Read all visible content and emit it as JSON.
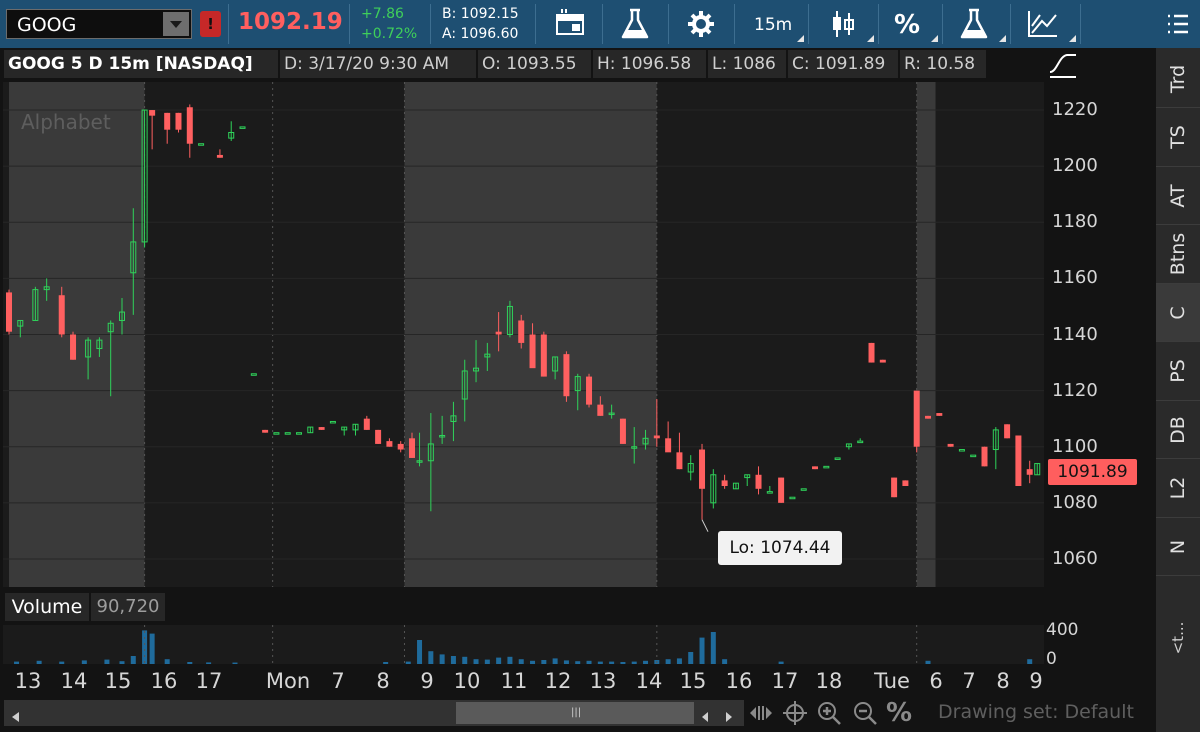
{
  "toolbar": {
    "symbol": "GOOG",
    "alert_badge": "!",
    "last_price": "1092.19",
    "change": "+7.86",
    "change_pct": "+0.72%",
    "bid": "B: 1092.15",
    "ask": "A: 1096.60",
    "aggregation": "15m",
    "icons": [
      "style-icon",
      "flask-icon",
      "gear-icon",
      "candle-chart-icon",
      "percent-icon",
      "flask-icon",
      "drawing-icon",
      "menu-icon"
    ]
  },
  "info_bar": {
    "title": "GOOG 5 D 15m [NASDAQ]",
    "date": "D: 3/17/20 9:30 AM",
    "open": "O: 1093.55",
    "high": "H: 1096.58",
    "low": "L: 1086",
    "close": "C: 1091.89",
    "range": "R: 10.58"
  },
  "chart": {
    "watermark": "Alphabet",
    "price_tag": "1091.89",
    "tooltip": "Lo: 1074.44",
    "colors": {
      "up": "#2fd35a",
      "down": "#ff6060",
      "volume": "#1f6b9c",
      "bg_dark": "#1b1b1b",
      "bg_light": "#3a3a3a"
    }
  },
  "volume": {
    "label": "Volume",
    "value": "90,720",
    "axis": [
      "400",
      "0"
    ]
  },
  "time_axis": [
    "13",
    "14",
    "15",
    "16",
    "17",
    "Mon",
    "7",
    "8",
    "9",
    "10",
    "11",
    "12",
    "13",
    "14",
    "15",
    "16",
    "17",
    "18",
    "Tue",
    "6",
    "7",
    "8",
    "9"
  ],
  "bottom": {
    "drawing_set": "Drawing set: Default"
  },
  "right_tabs": [
    "Trd",
    "TS",
    "AT",
    "Btns",
    "C",
    "PS",
    "DB",
    "L2",
    "N"
  ],
  "right_more": "<t...",
  "chart_data": {
    "type": "candlestick",
    "title": "GOOG 5 D 15m [NASDAQ]",
    "ylim": [
      1050,
      1230
    ],
    "y_ticks": [
      1220,
      1200,
      1180,
      1160,
      1140,
      1120,
      1100,
      1080,
      1060
    ],
    "session_shading": [
      {
        "from": 0,
        "to": 36,
        "type": "light"
      },
      {
        "from": 36,
        "to": 105,
        "type": "dark"
      },
      {
        "from": 105,
        "to": 172,
        "type": "light"
      },
      {
        "from": 172,
        "to": 241,
        "type": "dark"
      },
      {
        "from": 241,
        "to": 246,
        "type": "light"
      }
    ],
    "candles": [
      [
        0,
        1155,
        1156,
        1140,
        1141
      ],
      [
        3,
        1143,
        1145,
        1139,
        1145
      ],
      [
        7,
        1145,
        1157,
        1145,
        1156
      ],
      [
        10,
        1156,
        1160,
        1152,
        1157
      ],
      [
        14,
        1154,
        1157,
        1139,
        1140
      ],
      [
        17,
        1140,
        1141,
        1131,
        1131
      ],
      [
        21,
        1132,
        1139,
        1124,
        1138
      ],
      [
        24,
        1135,
        1139,
        1132,
        1138
      ],
      [
        27,
        1141,
        1145,
        1118,
        1144
      ],
      [
        30,
        1145,
        1153,
        1140,
        1148
      ],
      [
        33,
        1162,
        1185,
        1147,
        1173
      ],
      [
        36,
        1173,
        1220,
        1171,
        1220
      ],
      [
        38,
        1220,
        1220,
        1206,
        1218
      ],
      [
        42,
        1219,
        1219,
        1208,
        1213
      ],
      [
        45,
        1219,
        1219,
        1212,
        1213
      ],
      [
        48,
        1221,
        1222,
        1203,
        1208
      ],
      [
        51,
        1208,
        1208,
        1208,
        1208
      ],
      [
        56,
        1204,
        1206,
        1203,
        1203
      ],
      [
        59,
        1210,
        1216,
        1209,
        1212
      ],
      [
        62,
        1214,
        1214,
        1214,
        1214
      ],
      [
        65,
        1126,
        1126,
        1126,
        1126
      ],
      [
        68,
        1106,
        1106,
        1105,
        1105
      ],
      [
        71,
        1105,
        1105,
        1105,
        1105
      ],
      [
        74,
        1105,
        1105,
        1105,
        1105
      ],
      [
        77,
        1105,
        1105,
        1105,
        1105
      ],
      [
        80,
        1105,
        1107,
        1105,
        1107
      ],
      [
        83,
        1107,
        1107,
        1106,
        1106
      ],
      [
        86,
        1109,
        1109,
        1109,
        1109
      ],
      [
        89,
        1106,
        1107,
        1104,
        1107
      ],
      [
        92,
        1106,
        1108,
        1104,
        1108
      ],
      [
        95,
        1110,
        1111,
        1106,
        1106
      ],
      [
        98,
        1106,
        1106,
        1101,
        1101
      ],
      [
        101,
        1102,
        1103,
        1100,
        1100
      ],
      [
        104,
        1101,
        1102,
        1098,
        1099
      ],
      [
        107,
        1103,
        1105,
        1096,
        1096
      ],
      [
        109,
        1095,
        1105,
        1093,
        1095
      ],
      [
        112,
        1095,
        1112,
        1077,
        1101
      ],
      [
        115,
        1104,
        1111,
        1101,
        1104
      ],
      [
        118,
        1109,
        1116,
        1102,
        1111
      ],
      [
        121,
        1117,
        1131,
        1109,
        1127
      ],
      [
        124,
        1127,
        1138,
        1123,
        1128
      ],
      [
        127,
        1132,
        1137,
        1127,
        1133
      ],
      [
        130,
        1141,
        1148,
        1134,
        1140
      ],
      [
        133,
        1140,
        1152,
        1139,
        1150
      ],
      [
        136,
        1145,
        1147,
        1135,
        1137
      ],
      [
        139,
        1140,
        1144,
        1131,
        1128
      ],
      [
        142,
        1140,
        1141,
        1125,
        1125
      ],
      [
        145,
        1127,
        1132,
        1124,
        1132
      ],
      [
        148,
        1133,
        1134,
        1116,
        1118
      ],
      [
        151,
        1120,
        1126,
        1113,
        1125
      ],
      [
        154,
        1125,
        1126,
        1114,
        1115
      ],
      [
        157,
        1115,
        1118,
        1111,
        1111
      ],
      [
        160,
        1112,
        1115,
        1110,
        1112
      ],
      [
        163,
        1110,
        1110,
        1101,
        1101
      ],
      [
        166,
        1100,
        1107,
        1094,
        1100
      ],
      [
        169,
        1101,
        1106,
        1099,
        1103
      ],
      [
        172,
        1104,
        1117,
        1100,
        1103
      ],
      [
        175,
        1103,
        1109,
        1101,
        1098
      ],
      [
        178,
        1098,
        1105,
        1092,
        1092
      ],
      [
        181,
        1091,
        1097,
        1088,
        1094
      ],
      [
        184,
        1099,
        1101,
        1074,
        1085
      ],
      [
        187,
        1080,
        1092,
        1078,
        1090
      ],
      [
        190,
        1088,
        1090,
        1085,
        1086
      ],
      [
        193,
        1085,
        1087,
        1085,
        1087
      ],
      [
        196,
        1089,
        1090,
        1086,
        1090
      ],
      [
        199,
        1090,
        1093,
        1083,
        1085
      ],
      [
        202,
        1084,
        1086,
        1084,
        1084
      ],
      [
        205,
        1089,
        1089,
        1080,
        1080
      ],
      [
        208,
        1082,
        1082,
        1082,
        1082
      ],
      [
        211,
        1085,
        1085,
        1085,
        1085
      ],
      [
        214,
        1093,
        1093,
        1092,
        1092
      ],
      [
        217,
        1093,
        1093,
        1093,
        1093
      ],
      [
        220,
        1096,
        1096,
        1096,
        1096
      ],
      [
        223,
        1100,
        1101,
        1099,
        1101
      ],
      [
        226,
        1102,
        1103,
        1102,
        1102
      ],
      [
        229,
        1137,
        1137,
        1130,
        1130
      ],
      [
        232,
        1131,
        1131,
        1130,
        1130
      ],
      [
        235,
        1089,
        1089,
        1082,
        1082
      ],
      [
        238,
        1088,
        1088,
        1086,
        1086
      ],
      [
        241,
        1120,
        1120,
        1098,
        1100
      ],
      [
        244,
        1111,
        1111,
        1110,
        1110
      ],
      [
        247,
        1112,
        1112,
        1111,
        1111
      ],
      [
        250,
        1101,
        1101,
        1100,
        1100
      ],
      [
        253,
        1099,
        1099,
        1099,
        1099
      ],
      [
        256,
        1097,
        1097,
        1097,
        1097
      ],
      [
        259,
        1100,
        1100,
        1093,
        1093
      ],
      [
        262,
        1099,
        1107,
        1092,
        1106
      ],
      [
        265,
        1108,
        1108,
        1103,
        1103
      ],
      [
        268,
        1104,
        1104,
        1086,
        1086
      ],
      [
        271,
        1092,
        1095,
        1087,
        1090
      ],
      [
        273,
        1090,
        1094,
        1090,
        1094
      ]
    ],
    "volume": {
      "ylim": [
        0,
        450
      ],
      "bars": [
        [
          2,
          30
        ],
        [
          8,
          40
        ],
        [
          14,
          30
        ],
        [
          20,
          45
        ],
        [
          26,
          55
        ],
        [
          30,
          35
        ],
        [
          33,
          100
        ],
        [
          36,
          420
        ],
        [
          38,
          380
        ],
        [
          42,
          60
        ],
        [
          48,
          25
        ],
        [
          53,
          20
        ],
        [
          60,
          18
        ],
        [
          100,
          25
        ],
        [
          106,
          30
        ],
        [
          109,
          300
        ],
        [
          112,
          160
        ],
        [
          115,
          120
        ],
        [
          118,
          100
        ],
        [
          121,
          90
        ],
        [
          124,
          60
        ],
        [
          127,
          55
        ],
        [
          130,
          80
        ],
        [
          133,
          90
        ],
        [
          136,
          60
        ],
        [
          139,
          40
        ],
        [
          142,
          50
        ],
        [
          145,
          70
        ],
        [
          148,
          45
        ],
        [
          151,
          35
        ],
        [
          154,
          40
        ],
        [
          157,
          30
        ],
        [
          160,
          30
        ],
        [
          163,
          25
        ],
        [
          166,
          30
        ],
        [
          169,
          40
        ],
        [
          172,
          50
        ],
        [
          175,
          60
        ],
        [
          178,
          70
        ],
        [
          181,
          150
        ],
        [
          184,
          330
        ],
        [
          187,
          400
        ],
        [
          190,
          60
        ],
        [
          205,
          30
        ],
        [
          244,
          40
        ],
        [
          271,
          60
        ]
      ]
    }
  }
}
